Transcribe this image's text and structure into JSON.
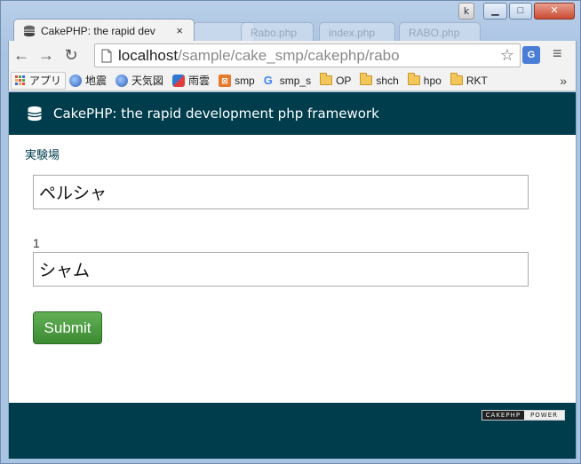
{
  "browser": {
    "window_user_label": "k",
    "tabs": [
      {
        "title": "CakePHP: the rapid dev",
        "close": "×",
        "active": true
      },
      {
        "title": "",
        "active": false
      },
      {
        "title": "Rabo.php",
        "active": false
      },
      {
        "title": "index.php",
        "active": false
      },
      {
        "title": "RABO.php",
        "active": false
      }
    ],
    "url_host": "localhost",
    "url_path": "/sample/cake_smp/cakephp/rabo",
    "bookmarks": [
      {
        "label": "アプリ",
        "icon": "apps-grid-icon"
      },
      {
        "label": "地震",
        "icon": "globe-icon"
      },
      {
        "label": "天気図",
        "icon": "globe-icon"
      },
      {
        "label": "雨雲",
        "icon": "cloud-icon"
      },
      {
        "label": "smp",
        "icon": "smp-icon"
      },
      {
        "label": "smp_s",
        "icon": "google-icon"
      },
      {
        "label": "OP",
        "icon": "folder-icon"
      },
      {
        "label": "shch",
        "icon": "folder-icon"
      },
      {
        "label": "hpo",
        "icon": "folder-icon"
      },
      {
        "label": "RKT",
        "icon": "folder-icon"
      }
    ],
    "bookmarks_more": "»"
  },
  "page": {
    "header_title": "CakePHP: the rapid development php framework",
    "breadcrumb": "実験場",
    "input1_value": "ペルシャ",
    "label_number": "1",
    "input2_value": "シャム",
    "submit_label": "Submit",
    "footer_badge_left": "CAKEPHP",
    "footer_badge_right": "POWER"
  },
  "colors": {
    "cake_header": "#003d4c",
    "submit_green": "#4a9a3f"
  }
}
